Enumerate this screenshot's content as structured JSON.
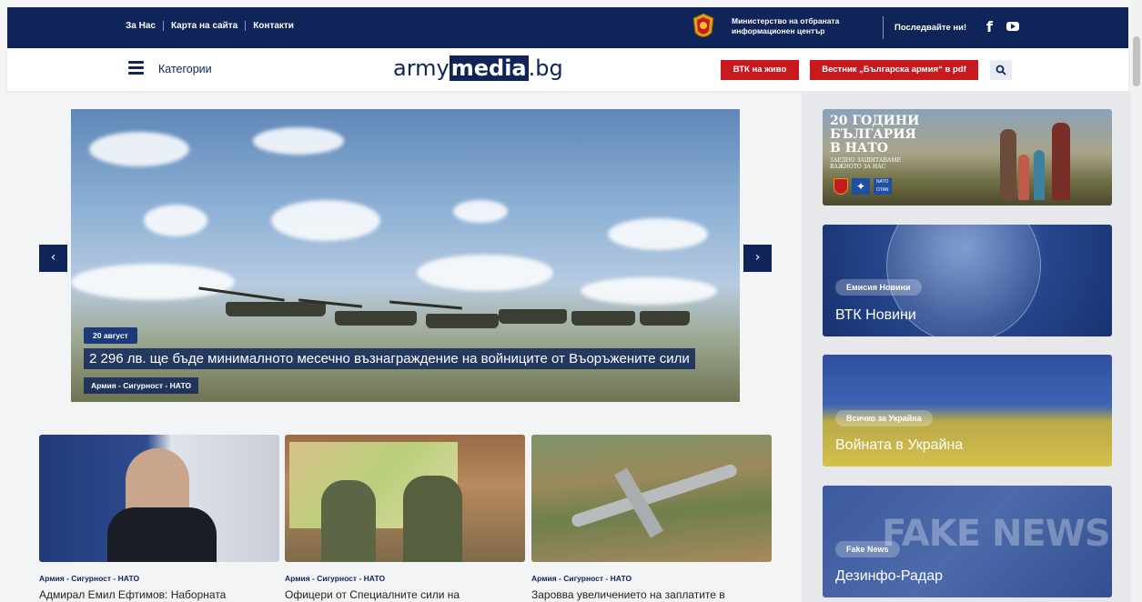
{
  "topbar": {
    "links": [
      "За Нас",
      "Карта на сайта",
      "Контакти"
    ],
    "ministry_line1": "Министерство на отбраната",
    "ministry_line2": "информационен център",
    "follow": "Последвайте ни!",
    "social": [
      "facebook-icon",
      "youtube-icon"
    ]
  },
  "nav": {
    "categories": "Категории",
    "logo_part1": "army",
    "logo_part2": "media",
    "logo_part3": ".bg",
    "live_button": "ВТК на живо",
    "pdf_button": "Вестник „Българска армия“ в pdf"
  },
  "hero": {
    "date": "20 август",
    "title": "2 296 лв. ще бъде минималното месечно възнаграждение на войниците от Въоръжените сили",
    "category": "Армия - Сигурност - НАТО",
    "prev": "‹",
    "next": "›"
  },
  "cards": [
    {
      "category": "Армия - Сигурност - НАТО",
      "title": "Адмирал Емил Ефтимов: Наборната"
    },
    {
      "category": "Армия - Сигурност - НАТО",
      "title": "Офицери от Специалните сили на"
    },
    {
      "category": "Армия - Сигурност - НАТО",
      "title": "Заровва увеличението на заплатите в"
    }
  ],
  "sidebar": {
    "nato": {
      "line1": "20 ГОДИНИ",
      "line2": "БЪЛГАРИЯ",
      "line3": "В НАТО",
      "sub1": "ЗАЕДНО ЗАЩИТАВАМЕ",
      "sub2": "ВАЖНОТО ЗА НАС",
      "badge1": "NATO",
      "badge2": "OTAN"
    },
    "vtk": {
      "label": "Емисия Новини",
      "title": "ВТК Новини"
    },
    "ukraine": {
      "label": "Всичко за Украйна",
      "title": "Войната в Украйна"
    },
    "fake": {
      "label": "Fake News",
      "title": "Дезинфо-Радар",
      "bg_text": "FAKE NEWS"
    }
  },
  "colors": {
    "navy": "#0f2559",
    "red": "#c8191e"
  }
}
